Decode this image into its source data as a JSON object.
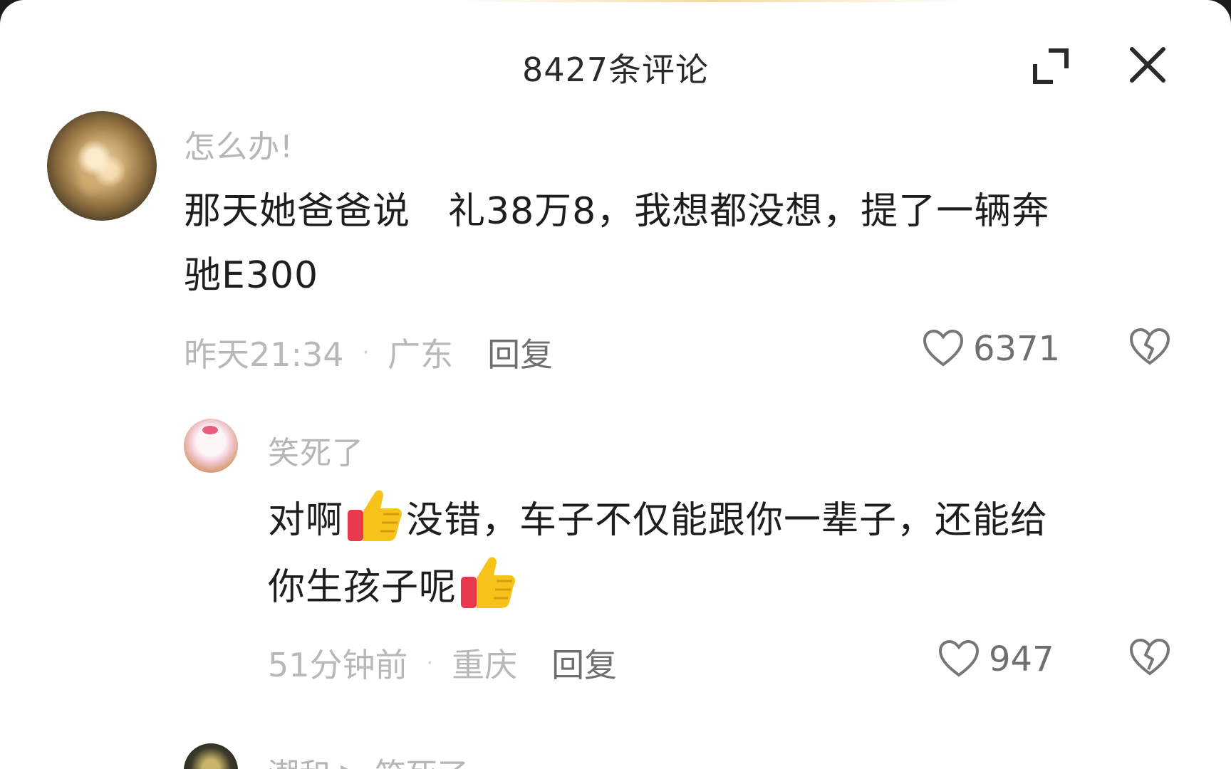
{
  "header": {
    "title": "8427条评论"
  },
  "comments": [
    {
      "username": "怎么办!",
      "text_line1": "那天她爸爸说　礼38万8，我想都没想，提了一辆奔",
      "text_line2": "驰E300",
      "time": "昨天21:34",
      "location": "广东",
      "reply_label": "回复",
      "likes": "6371"
    }
  ],
  "replies": [
    {
      "username": "笑死了",
      "text_part1": "对啊",
      "text_part2": "没错，车子不仅能跟你一辈子，还能给",
      "text_part3": "你生孩子呢",
      "emoji": "thumbs-up",
      "time": "51分钟前",
      "location": "重庆",
      "reply_label": "回复",
      "likes": "947"
    }
  ],
  "next_comment": {
    "username": "潮和 ▶ 笑死了"
  },
  "colors": {
    "background": "#ffffff",
    "text_primary": "#1e1e1e",
    "text_muted": "#b6b6b6",
    "thumb_yellow": "#f7c21a",
    "thumb_red": "#e8394e"
  }
}
